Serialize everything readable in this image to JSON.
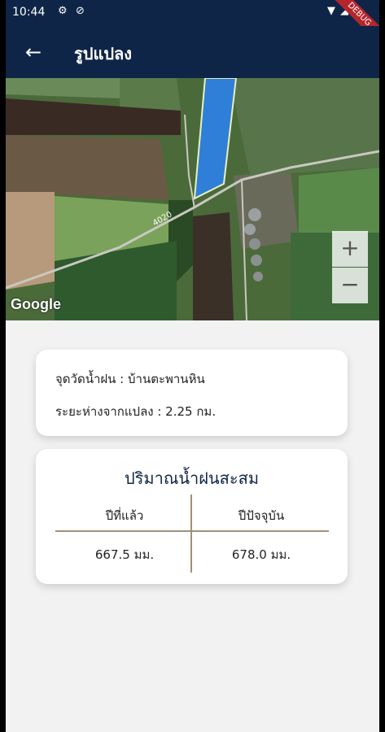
{
  "status": {
    "time": "10:44",
    "debug_banner": "DEBUG"
  },
  "appbar": {
    "title": "รูปแปลง"
  },
  "map": {
    "attribution": "Google",
    "road_label": "4020",
    "zoom_in": "+",
    "zoom_out": "−"
  },
  "station": {
    "station_label": "จุดวัดน้ำฝน : บ้านตะพานหิน",
    "distance_label": "ระยะห่างจากแปลง : 2.25 กม."
  },
  "rainfall": {
    "title": "ปริมาณน้ำฝนสะสม",
    "last_year_label": "ปีที่แล้ว",
    "this_year_label": "ปีปัจจุบัน",
    "last_year_value": "667.5 มม.",
    "this_year_value": "678.0 มม."
  },
  "colors": {
    "primary": "#0f2547",
    "plot_fill": "#2f7fd8",
    "divider": "#a0907a"
  }
}
